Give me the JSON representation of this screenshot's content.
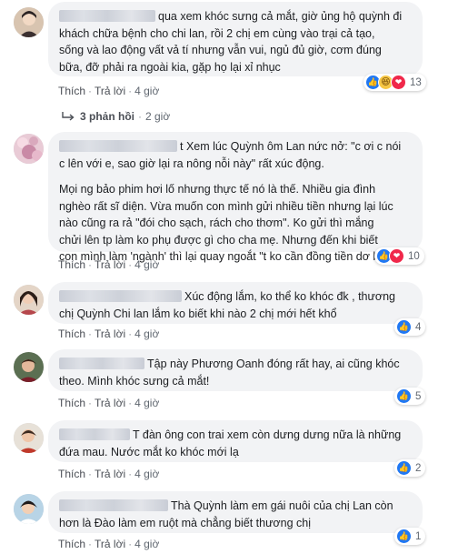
{
  "actions": {
    "like": "Thích",
    "reply": "Trả lời",
    "separator": "·"
  },
  "comments": [
    {
      "text_lines": [
        "qua xem khóc sưng cả mắt, giờ ủng hộ quỳnh đi",
        "khách chữa bệnh cho chi lan, rồi 2 chị em cùng vào trại cả tạo,",
        "sống và lao động vất vả tí nhưng vẫn vui, ngủ đủ giờ, cơm đúng",
        "bữa, đỡ phải ra ngoài kia, gặp họ lại xỉ nhục"
      ],
      "time": "4 giờ",
      "reaction_icons": [
        "like-icon",
        "haha-icon",
        "love-icon"
      ],
      "reaction_count": "13",
      "replies": {
        "label": "3 phản hồi",
        "time": "2 giờ"
      }
    },
    {
      "text_lines": [
        "t Xem lúc Quỳnh ôm Lan nức nở: \"c ơi c nói",
        "c lên với e, sao giờ lại ra nông nỗi này\" rất xúc động.",
        "",
        "Mọi ng bảo phim hơi lố nhưng thực tế nó là thế. Nhiều gia đình",
        "nghèo rất sĩ diện. Vừa muốn con mình gửi nhiều tiền nhưng lại lúc",
        "nào cũng ra rả \"đói cho sạch, rách cho thơm\". Ko gửi thì mắng",
        "chửi lên tp làm ko phụ được gì cho cha mẹ. Nhưng đến khi biết",
        "con mình làm 'ngành' thì lại quay ngoắt \"t ko cần đồng tiền dơ bẩn\"."
      ],
      "time": "4 giờ",
      "reaction_icons": [
        "like-icon",
        "love-icon"
      ],
      "reaction_count": "10"
    },
    {
      "text_lines": [
        "Xúc động lắm, ko thể ko khóc đk , thương",
        "chị Quỳnh Chi lan lắm ko biết khi nào 2 chị mới hết khổ"
      ],
      "time": "4 giờ",
      "reaction_icons": [
        "like-icon"
      ],
      "reaction_count": "4"
    },
    {
      "text_lines": [
        "Tập này Phương Oanh đóng rất hay, ai cũng khóc",
        "theo. Mình khóc sưng cả mắt!"
      ],
      "time": "4 giờ",
      "reaction_icons": [
        "like-icon"
      ],
      "reaction_count": "5"
    },
    {
      "text_lines": [
        "T đàn ông con trai xem còn dưng dưng nữa là những",
        "đứa mau. Nước mắt ko khóc mới lạ"
      ],
      "time": "4 giờ",
      "reaction_icons": [
        "like-icon"
      ],
      "reaction_count": "2"
    },
    {
      "text_lines": [
        "Thà Quỳnh làm em gái nuôi của chị Lan còn",
        "hơn là Đào làm em ruột mà chẳng biết thương chị"
      ],
      "time": "4 giờ",
      "reaction_icons": [
        "like-icon"
      ],
      "reaction_count": "1"
    }
  ]
}
